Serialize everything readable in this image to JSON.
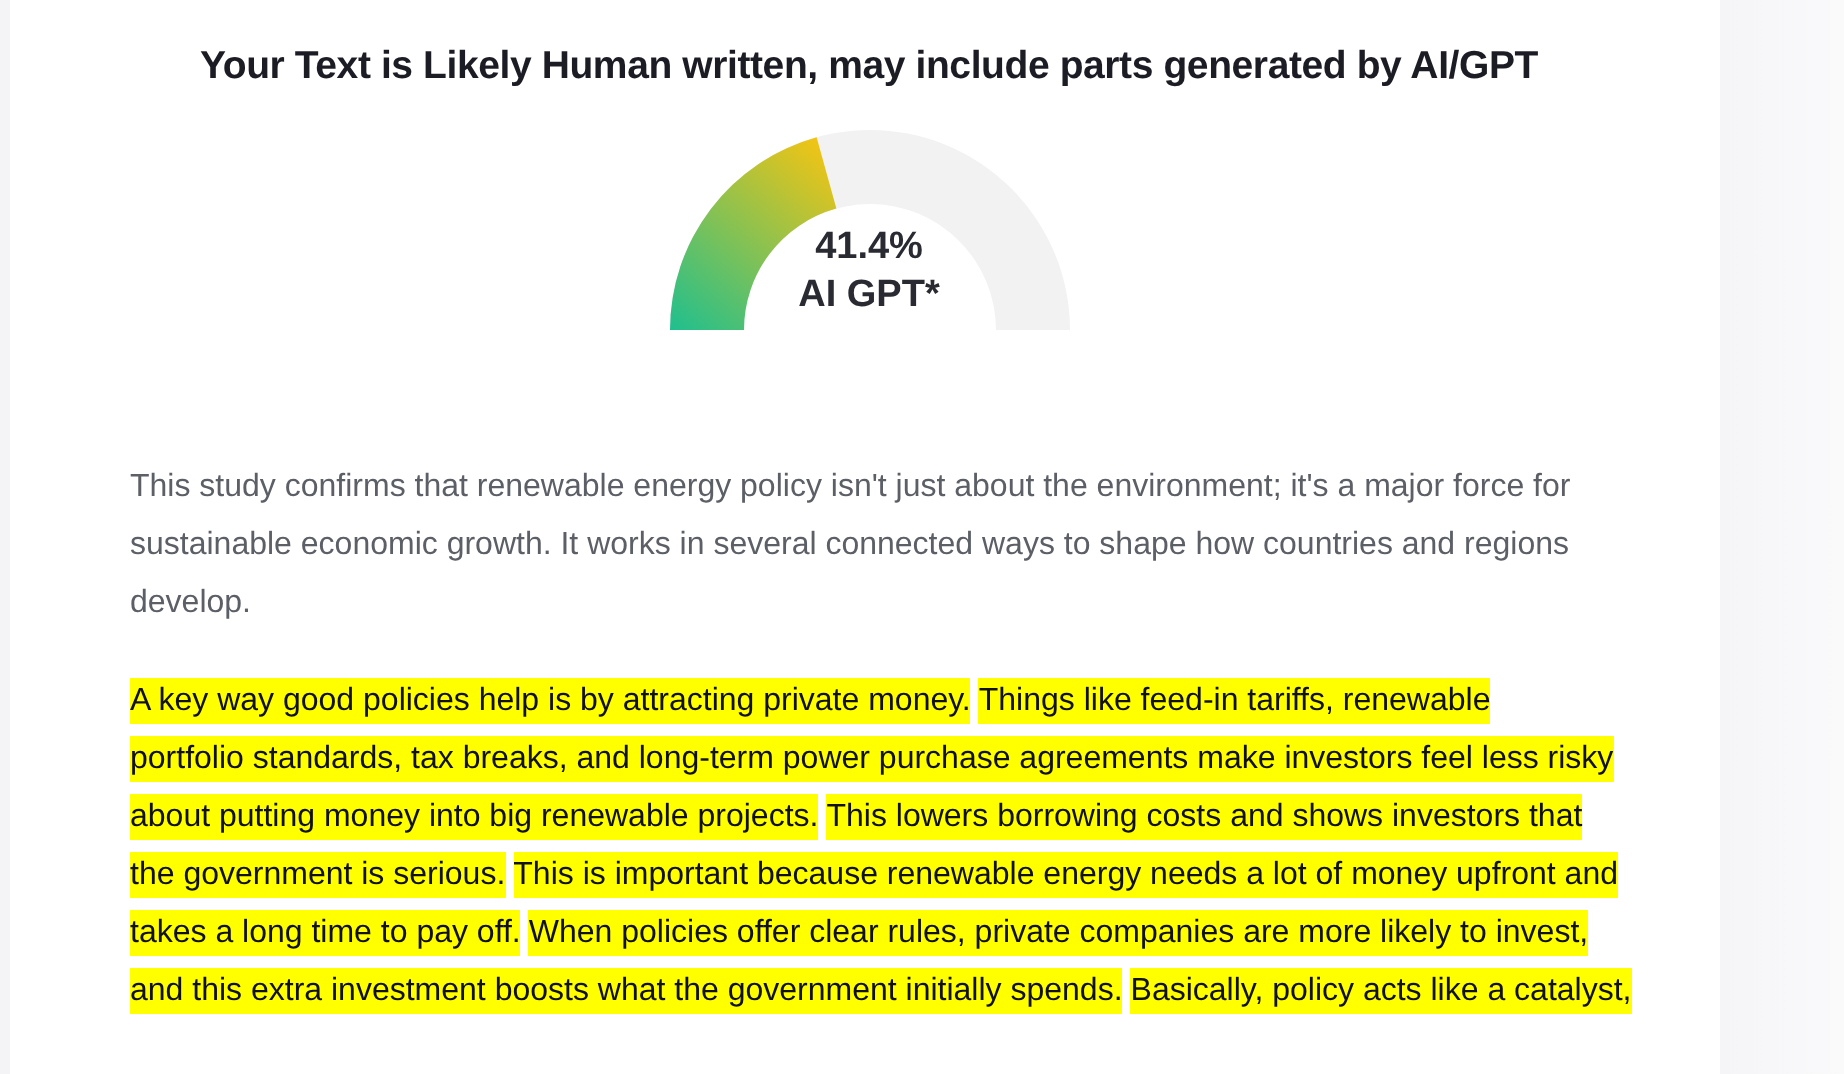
{
  "result": {
    "title": "Your Text is Likely Human written, may include parts generated by AI/GPT",
    "gauge": {
      "percent": "41.4%",
      "label": "AI GPT*"
    }
  },
  "intro": "This study confirms that renewable energy policy isn't just about the environment; it's a major force for sustainable economic growth. It works in several connected ways to shape how countries and regions develop.",
  "lines": [
    {
      "segments": [
        {
          "text": "A key way good policies help is by attracting private money.",
          "highlighted": true
        },
        {
          "text": "Things like feed-in tariffs, renewable",
          "highlighted": true
        }
      ]
    },
    {
      "segments": [
        {
          "text": "portfolio standards, tax breaks, and long-term power purchase agreements make investors feel less risky",
          "highlighted": true
        }
      ]
    },
    {
      "segments": [
        {
          "text": "about putting money into big renewable projects.",
          "highlighted": true
        },
        {
          "text": "This lowers borrowing costs and shows investors that",
          "highlighted": true
        }
      ]
    },
    {
      "segments": [
        {
          "text": "the government is serious.",
          "highlighted": true
        },
        {
          "text": "This is important because renewable energy needs a lot of money upfront and",
          "highlighted": true
        }
      ]
    },
    {
      "segments": [
        {
          "text": "takes a long time to pay off.",
          "highlighted": true
        },
        {
          "text": "When policies offer clear rules, private companies are more likely to invest,",
          "highlighted": true
        }
      ]
    },
    {
      "segments": [
        {
          "text": "and this extra investment boosts what the government initially spends.",
          "highlighted": true
        },
        {
          "text": "Basically, policy acts like a catalyst,",
          "highlighted": true
        }
      ]
    }
  ]
}
